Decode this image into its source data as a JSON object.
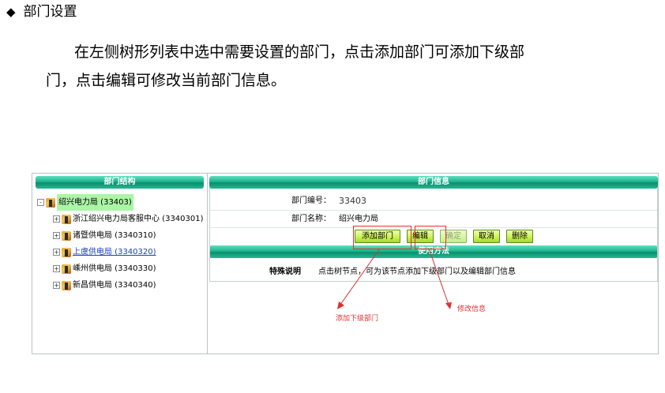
{
  "doc": {
    "heading_bullet": "◆",
    "heading": "部门设置",
    "para_line1": "在左侧树形列表中选中需要设置的部门，点击添加部门可添加下级部",
    "para_line2": "门，点击编辑可修改当前部门信息。"
  },
  "left": {
    "title": "部门结构",
    "tree": [
      {
        "label": "绍兴电力局 (33403)",
        "toggle": "-"
      },
      {
        "label": "浙江绍兴电力局客服中心 (3340301)",
        "toggle": "+"
      },
      {
        "label": "诸暨供电局 (3340310)",
        "toggle": "+"
      },
      {
        "label": "上虞供电局 (3340320)",
        "toggle": "+"
      },
      {
        "label": "嵊州供电局 (3340330)",
        "toggle": "+"
      },
      {
        "label": "新昌供电局 (3340340)",
        "toggle": "+"
      }
    ]
  },
  "right": {
    "title": "部门信息",
    "dept_no_label": "部门编号：",
    "dept_no_value": "33403",
    "dept_name_label": "部门名称：",
    "dept_name_value": "绍兴电力局",
    "buttons": {
      "add": "添加部门",
      "edit": "编辑",
      "confirm": "确定",
      "cancel": "取消",
      "delete": "删除"
    },
    "usage_title": "使用方法",
    "note_title": "特殊说明",
    "note_text": "点击树节点，可为该节点添加下级部门以及编辑部门信息"
  },
  "annotations": {
    "add_sub": "添加下级部门",
    "modify": "修改信息"
  },
  "colors": {
    "bar_green": "#1fb48d",
    "button_green": "#c9f04f",
    "annotation_red": "#e03030",
    "root_highlight": "#aaf5a6"
  }
}
